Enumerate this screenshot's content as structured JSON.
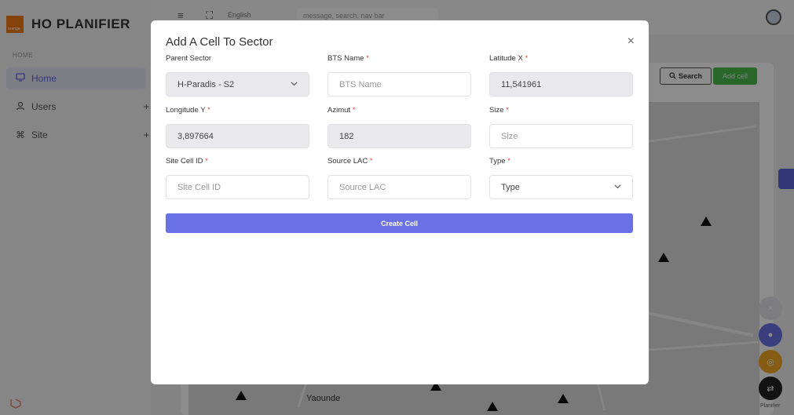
{
  "app": {
    "brand": "HO PLANIFIER",
    "brand_logo_text": "orange",
    "section_label": "HOME",
    "sidebar": [
      {
        "label": "Home"
      },
      {
        "label": "Users"
      },
      {
        "label": "Site"
      }
    ],
    "topbar": {
      "language": "English",
      "search_placeholder": "message, search, nav bar"
    },
    "content": {
      "search_button": "Search",
      "add_cell_button": "Add cell",
      "map_city_label": "Yaounde",
      "footer_tag": "Planifier"
    }
  },
  "modal": {
    "title": "Add A Cell To Sector",
    "close_glyph": "×",
    "fields": {
      "parent_sector": {
        "label": "Parent Sector",
        "value": "H-Paradis - S2"
      },
      "bts_name": {
        "label": "BTS Name",
        "required": "*",
        "placeholder": "BTS Name"
      },
      "latitude": {
        "label": "Latitude X",
        "required": "*",
        "value": "11,541961"
      },
      "longitude": {
        "label": "Longitude Y",
        "required": "*",
        "value": "3,897664"
      },
      "azimut": {
        "label": "Azimut",
        "required": "*",
        "value": "182"
      },
      "size": {
        "label": "Size",
        "required": "*",
        "placeholder": "Size"
      },
      "site_cell_id": {
        "label": "Site Cell ID",
        "required": "*",
        "placeholder": "Site Cell ID"
      },
      "source_lac": {
        "label": "Source LAC",
        "required": "*",
        "placeholder": "Source LAC"
      },
      "type": {
        "label": "Type",
        "required": "*",
        "value": "Type"
      }
    },
    "submit_label": "Create Cell"
  },
  "colors": {
    "accent": "#6a71e4",
    "required": "#e04848",
    "brand_orange": "#f07a14",
    "add_green": "#4cbb4c"
  }
}
